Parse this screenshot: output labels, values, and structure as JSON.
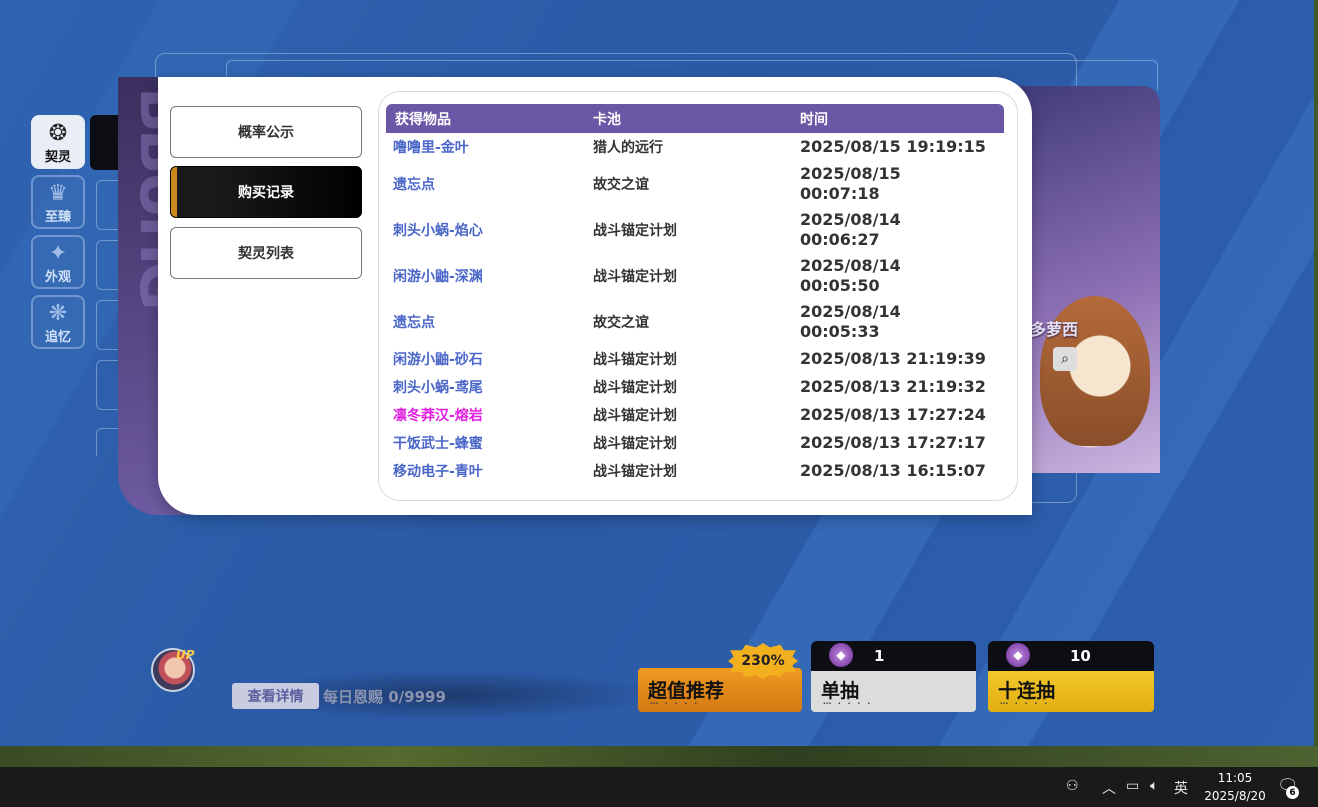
{
  "side_nav": [
    {
      "label": "契灵",
      "icon": "contract-spirit-icon",
      "active": true
    },
    {
      "label": "至臻",
      "icon": "wings-crest-icon",
      "active": false
    },
    {
      "label": "外观",
      "icon": "sparkle-icon",
      "active": false
    },
    {
      "label": "追忆",
      "icon": "memory-wave-icon",
      "active": false
    }
  ],
  "character": {
    "name_fragment": "多萝西"
  },
  "dialog": {
    "tabs": [
      {
        "label": "概率公示",
        "active": false
      },
      {
        "label": "购买记录",
        "active": true
      },
      {
        "label": "契灵列表",
        "active": false
      }
    ],
    "table": {
      "headers": [
        "获得物品",
        "卡池",
        "时间"
      ],
      "rows": [
        {
          "item": "噜噜里-金叶",
          "pool": "猎人的远行",
          "time_line1": "2025/08/15 19:19:15",
          "time_line2": "",
          "color": "#4b66c9"
        },
        {
          "item": "遗忘点",
          "pool": "故交之谊",
          "time_line1": "2025/08/15",
          "time_line2": "00:07:18",
          "color": "#4b66c9"
        },
        {
          "item": "刺头小蜗-焰心",
          "pool": "战斗锚定计划",
          "time_line1": "2025/08/14",
          "time_line2": "00:06:27",
          "color": "#4b66c9"
        },
        {
          "item": "闲游小鼬-深渊",
          "pool": "战斗锚定计划",
          "time_line1": "2025/08/14",
          "time_line2": "00:05:50",
          "color": "#4b66c9"
        },
        {
          "item": "遗忘点",
          "pool": "故交之谊",
          "time_line1": "2025/08/14",
          "time_line2": "00:05:33",
          "color": "#4b66c9"
        },
        {
          "item": "闲游小鼬-砂石",
          "pool": "战斗锚定计划",
          "time_line1": "2025/08/13 21:19:39",
          "time_line2": "",
          "color": "#4b66c9"
        },
        {
          "item": "刺头小蜗-鸢尾",
          "pool": "战斗锚定计划",
          "time_line1": "2025/08/13 21:19:32",
          "time_line2": "",
          "color": "#4b66c9"
        },
        {
          "item": "凛冬莽汉-熔岩",
          "pool": "战斗锚定计划",
          "time_line1": "2025/08/13 17:27:24",
          "time_line2": "",
          "color": "#e020e0"
        },
        {
          "item": "干饭武士-蜂蜜",
          "pool": "战斗锚定计划",
          "time_line1": "2025/08/13 17:27:17",
          "time_line2": "",
          "color": "#4b66c9"
        },
        {
          "item": "移动电子-青叶",
          "pool": "战斗锚定计划",
          "time_line1": "2025/08/13 16:15:07",
          "time_line2": "",
          "color": "#4b66c9"
        }
      ]
    }
  },
  "bottom": {
    "up_badge": "UP",
    "detail_button": "查看详情",
    "daily_label": "每日恩赐 0/9999",
    "promo": {
      "badge": "230%",
      "label": "超值推荐"
    },
    "single": {
      "count": "1",
      "label": "单抽"
    },
    "ten": {
      "count": "10",
      "label": "十连抽"
    },
    "dots": "⋯ · · · ·"
  },
  "taskbar": {
    "ime": "英",
    "time": "11:05",
    "date": "2025/8/20",
    "notifications": "6"
  }
}
